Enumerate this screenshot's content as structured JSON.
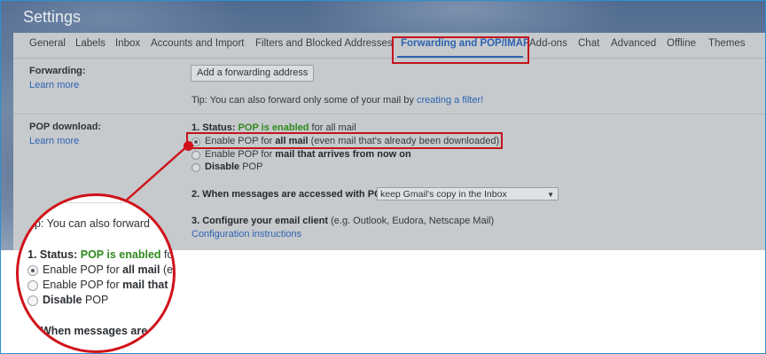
{
  "window": {
    "title": "Settings"
  },
  "tabs": [
    {
      "label": "General"
    },
    {
      "label": "Labels"
    },
    {
      "label": "Inbox"
    },
    {
      "label": "Accounts and Import"
    },
    {
      "label": "Filters and Blocked Addresses"
    },
    {
      "label": "Forwarding and POP/IMAP",
      "active": true
    },
    {
      "label": "Add-ons"
    },
    {
      "label": "Chat"
    },
    {
      "label": "Advanced"
    },
    {
      "label": "Offline"
    },
    {
      "label": "Themes"
    }
  ],
  "forwarding": {
    "label": "Forwarding:",
    "learn_more": "Learn more",
    "add_button": "Add a forwarding address",
    "tip_prefix": "Tip: You can also forward only some of your mail by ",
    "tip_link": "creating a filter!"
  },
  "pop": {
    "label": "POP download:",
    "learn_more": "Learn more",
    "status_prefix": "1. Status: ",
    "status_value": "POP is enabled",
    "status_suffix": " for all mail",
    "options": [
      {
        "pre": "Enable POP for ",
        "bold": "all mail",
        "post": " (even mail that's already been downloaded)",
        "selected": true
      },
      {
        "pre": "Enable POP for ",
        "bold": "mail that arrives from now on",
        "post": "",
        "selected": false
      },
      {
        "pre": "",
        "bold": "Disable",
        "post": " POP",
        "selected": false
      }
    ],
    "access_label": "2. When messages are accessed with POP",
    "access_value": "keep Gmail's copy in the Inbox",
    "configure_bold": "3. Configure your email client",
    "configure_rest": " (e.g. Outlook, Eudora, Netscape Mail)",
    "configure_link": "Configuration instructions"
  },
  "magnifier": {
    "tip_fragment": "p: You can also forward",
    "status_prefix": "1. Status: ",
    "status_value": "POP is enabled",
    "status_suffix": " fo",
    "options": [
      {
        "pre": "Enable POP for ",
        "bold": "all mail",
        "post": " (ev",
        "selected": true
      },
      {
        "pre": "Enable POP for ",
        "bold": "mail that a",
        "post": "",
        "selected": false
      },
      {
        "pre": "",
        "bold": "Disable",
        "post": " POP",
        "selected": false
      }
    ],
    "access_fragment": "When messages are ac"
  },
  "colors": {
    "accent": "#2e63b0",
    "highlight": "#c3151d",
    "status_green": "#2f8a1f"
  }
}
